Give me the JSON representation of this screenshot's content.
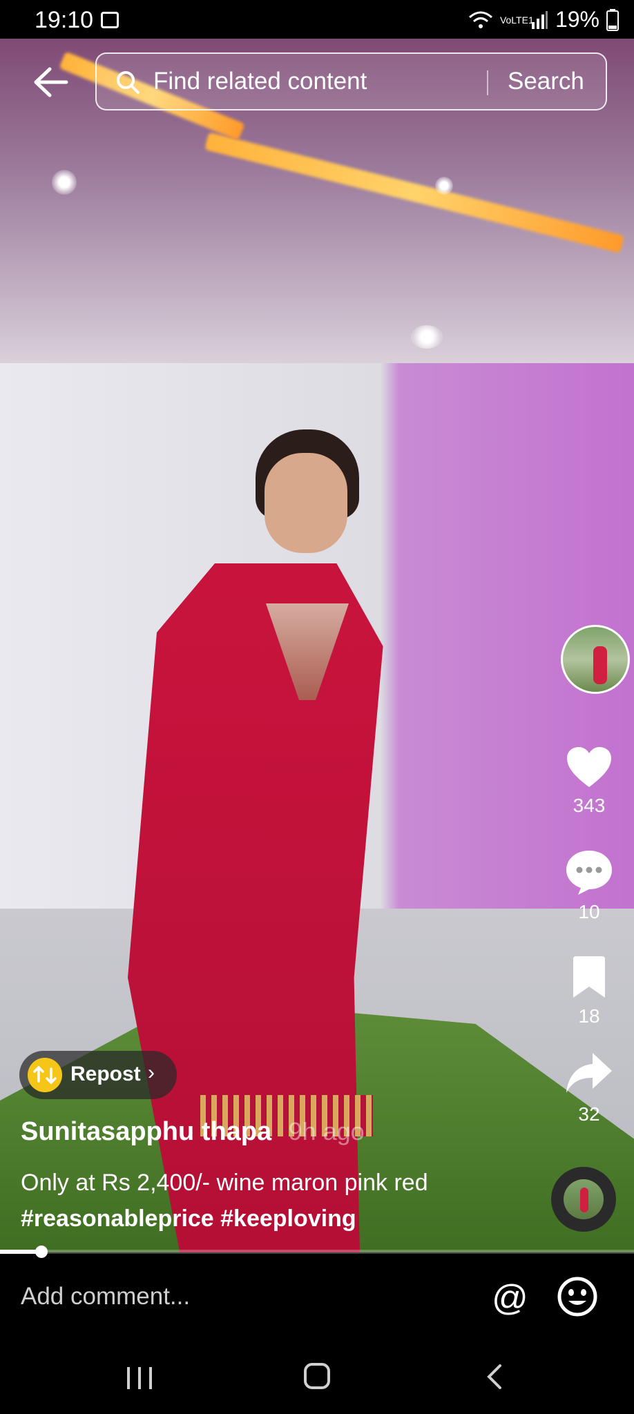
{
  "status": {
    "time": "19:10",
    "network": "VoLTE1",
    "battery": "19%"
  },
  "search": {
    "placeholder": "Find related content",
    "button": "Search"
  },
  "actions": {
    "likes": "343",
    "comments": "10",
    "bookmarks": "18",
    "shares": "32"
  },
  "repost": {
    "label": "Repost",
    "chevron": "›"
  },
  "post": {
    "username": "Sunitasapphu thapa",
    "time_ago": "9h ago",
    "description": "Only at Rs 2,400/- wine maron pink red",
    "hashtags": "#reasonableprice #keeploving"
  },
  "progress": {
    "value": 0.065
  },
  "comment": {
    "placeholder": "Add comment...",
    "at_symbol": "@"
  },
  "icons": [
    "back-arrow-icon",
    "search-icon",
    "heart-icon",
    "comment-icon",
    "bookmark-icon",
    "share-icon",
    "repost-icon",
    "emoji-icon",
    "gallery-icon",
    "wifi-icon",
    "signal-icon",
    "battery-icon"
  ],
  "colors": {
    "accent_yellow": "#f5c518",
    "dress_red": "#c8143d",
    "wall_purple": "#c272cf"
  }
}
